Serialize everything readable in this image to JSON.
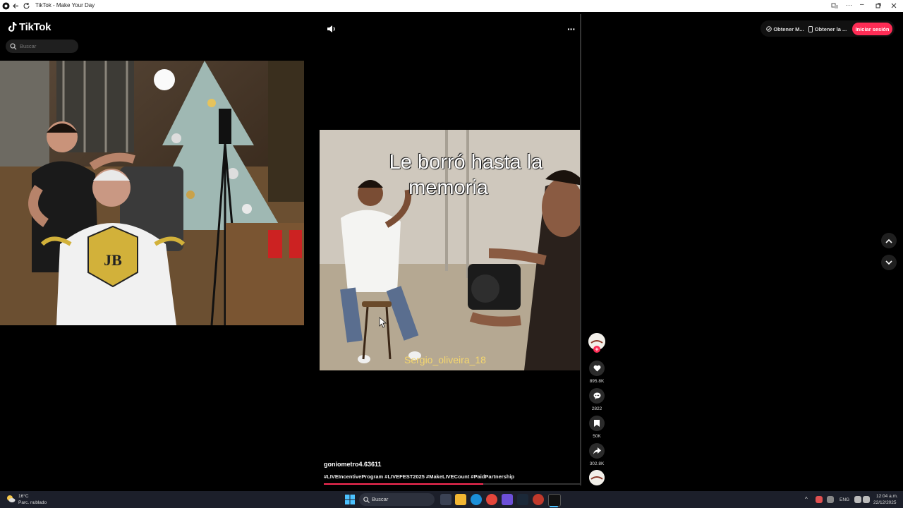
{
  "window": {
    "title": "TikTok - Make Your Day"
  },
  "header": {
    "logo_text": "TikTok",
    "search_placeholder": "Buscar",
    "get_app_1": "Obtener M...",
    "get_app_2": "Obtener la ...",
    "login": "Iniciar sesión"
  },
  "video": {
    "caption_line1": "Le borró hasta la",
    "caption_line2": "memoria",
    "watermark": "Sergio_oliveira_18",
    "author": "goniometro4.63611",
    "hashtags": "#LIVEIncentiveProgram #LIVEFEST2025 #MakeLIVECount #PaidPartnership",
    "progress": 0.62
  },
  "actions": {
    "likes": "895.8K",
    "comments": "2822",
    "saves": "50K",
    "shares": "302.8K"
  },
  "taskbar": {
    "weather_temp": "16°C",
    "weather_desc": "Parc. nublado",
    "search_label": "Buscar",
    "lang": "ENG",
    "time": "12:04 a.m.",
    "date": "22/12/2025"
  },
  "colors": {
    "accent": "#fe2c55",
    "background": "#000000",
    "taskbar": "#1c1f2a"
  }
}
